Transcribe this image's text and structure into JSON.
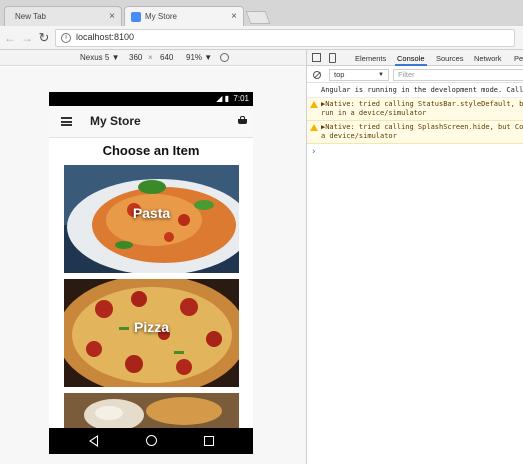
{
  "browser": {
    "tabs": [
      {
        "label": "New Tab",
        "active": false
      },
      {
        "label": "My Store",
        "active": true
      }
    ],
    "url": "localhost:8100",
    "close_glyph": "×"
  },
  "device_toolbar": {
    "device": "Nexus 5 ▼",
    "width": "360",
    "times": "×",
    "height": "640",
    "zoom": "91% ▼"
  },
  "phone": {
    "time": "7:01",
    "signal": "◢ ▮",
    "app_title": "My Store",
    "heading": "Choose an Item",
    "items": [
      {
        "label": "Pasta"
      },
      {
        "label": "Pizza"
      },
      {
        "label": ""
      }
    ]
  },
  "devtools": {
    "tabs": [
      "Elements",
      "Console",
      "Sources",
      "Network",
      "Pe"
    ],
    "active_tab": "Console",
    "context": "top",
    "filter_placeholder": "Filter",
    "messages": [
      {
        "level": "info",
        "lines": [
          "Angular is running in the development mode. Call"
        ]
      },
      {
        "level": "warn",
        "lines": [
          "▶Native: tried calling StatusBar.styleDefault, bu",
          "run in a device/simulator"
        ]
      },
      {
        "level": "warn",
        "lines": [
          "▶Native: tried calling SplashScreen.hide, but Cor",
          "a device/simulator"
        ]
      }
    ],
    "prompt": "›"
  },
  "colors": {
    "accent": "#3879d9",
    "warn_bg": "#fffbe5",
    "statusbar": "#000000"
  }
}
